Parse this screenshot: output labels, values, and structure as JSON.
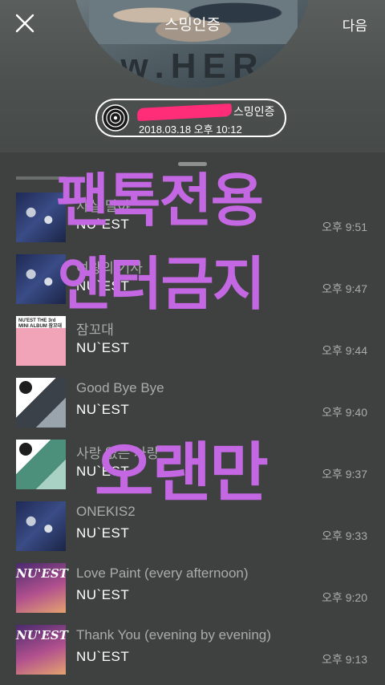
{
  "header": {
    "title": "스밍인증",
    "next_label": "다음",
    "album_letters": "ᴡ.HER",
    "current_track": {
      "title_suffix": "스밍인증",
      "timestamp": "2018.03.18 오후 10:12"
    }
  },
  "tracks": [
    {
      "title": "사실 말야",
      "artist": "NU`EST",
      "time": "오후 9:51",
      "cover": "blue"
    },
    {
      "title": "여왕의 기사",
      "artist": "NU`EST",
      "time": "오후 9:47",
      "cover": "blue"
    },
    {
      "title": "잠꼬대",
      "artist": "NU`EST",
      "time": "오후 9:44",
      "cover": "pink"
    },
    {
      "title": "Good Bye Bye",
      "artist": "NU`EST",
      "time": "오후 9:40",
      "cover": "white"
    },
    {
      "title": "사랑 없는 사랑",
      "artist": "NU`EST",
      "time": "오후 9:37",
      "cover": "white-green"
    },
    {
      "title": "ONEKIS2",
      "artist": "NU`EST",
      "time": "오후 9:33",
      "cover": "blue"
    },
    {
      "title": "Love Paint (every afternoon)",
      "artist": "NU`EST",
      "time": "오후 9:20",
      "cover": "purple"
    },
    {
      "title": "Thank You (evening by evening)",
      "artist": "NU`EST",
      "time": "오후 9:13",
      "cover": "purple"
    }
  ],
  "cover_text": {
    "pink_caption": "NU'EST THE 3rd MINI ALBUM 잠꼬대",
    "purple_brand": "NU'EST"
  },
  "watermark": {
    "line1": "팬톡전용",
    "line2": "엔터금지",
    "line3": "오랜만"
  },
  "colors": {
    "watermark": "#c467e3",
    "redaction": "#ff2d78"
  }
}
